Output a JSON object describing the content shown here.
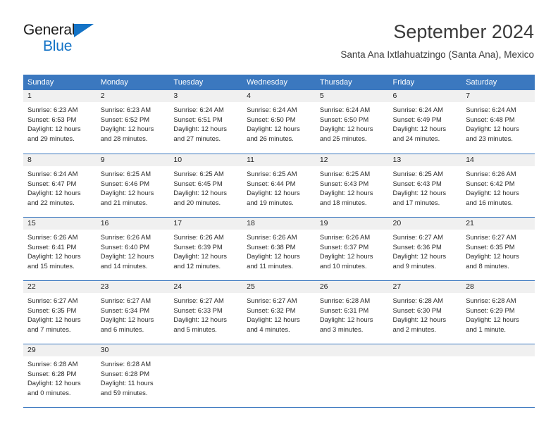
{
  "brand": {
    "name_top": "General",
    "name_bottom": "Blue",
    "triangle_icon": "blue-triangle-icon",
    "accent_color": "#1473c6"
  },
  "header": {
    "title": "September 2024",
    "subtitle": "Santa Ana Ixtlahuatzingo (Santa Ana), Mexico"
  },
  "theme": {
    "header_blue": "#3b78bf",
    "daynum_bg": "#f0f0f0",
    "text": "#222222"
  },
  "weekday_headers": [
    "Sunday",
    "Monday",
    "Tuesday",
    "Wednesday",
    "Thursday",
    "Friday",
    "Saturday"
  ],
  "labels": {
    "sunrise_prefix": "Sunrise:",
    "sunset_prefix": "Sunset:",
    "daylight_prefix": "Daylight:"
  },
  "weeks": [
    [
      {
        "day": "1",
        "sunrise": "Sunrise: 6:23 AM",
        "sunset": "Sunset: 6:53 PM",
        "daylight1": "Daylight: 12 hours",
        "daylight2": "and 29 minutes."
      },
      {
        "day": "2",
        "sunrise": "Sunrise: 6:23 AM",
        "sunset": "Sunset: 6:52 PM",
        "daylight1": "Daylight: 12 hours",
        "daylight2": "and 28 minutes."
      },
      {
        "day": "3",
        "sunrise": "Sunrise: 6:24 AM",
        "sunset": "Sunset: 6:51 PM",
        "daylight1": "Daylight: 12 hours",
        "daylight2": "and 27 minutes."
      },
      {
        "day": "4",
        "sunrise": "Sunrise: 6:24 AM",
        "sunset": "Sunset: 6:50 PM",
        "daylight1": "Daylight: 12 hours",
        "daylight2": "and 26 minutes."
      },
      {
        "day": "5",
        "sunrise": "Sunrise: 6:24 AM",
        "sunset": "Sunset: 6:50 PM",
        "daylight1": "Daylight: 12 hours",
        "daylight2": "and 25 minutes."
      },
      {
        "day": "6",
        "sunrise": "Sunrise: 6:24 AM",
        "sunset": "Sunset: 6:49 PM",
        "daylight1": "Daylight: 12 hours",
        "daylight2": "and 24 minutes."
      },
      {
        "day": "7",
        "sunrise": "Sunrise: 6:24 AM",
        "sunset": "Sunset: 6:48 PM",
        "daylight1": "Daylight: 12 hours",
        "daylight2": "and 23 minutes."
      }
    ],
    [
      {
        "day": "8",
        "sunrise": "Sunrise: 6:24 AM",
        "sunset": "Sunset: 6:47 PM",
        "daylight1": "Daylight: 12 hours",
        "daylight2": "and 22 minutes."
      },
      {
        "day": "9",
        "sunrise": "Sunrise: 6:25 AM",
        "sunset": "Sunset: 6:46 PM",
        "daylight1": "Daylight: 12 hours",
        "daylight2": "and 21 minutes."
      },
      {
        "day": "10",
        "sunrise": "Sunrise: 6:25 AM",
        "sunset": "Sunset: 6:45 PM",
        "daylight1": "Daylight: 12 hours",
        "daylight2": "and 20 minutes."
      },
      {
        "day": "11",
        "sunrise": "Sunrise: 6:25 AM",
        "sunset": "Sunset: 6:44 PM",
        "daylight1": "Daylight: 12 hours",
        "daylight2": "and 19 minutes."
      },
      {
        "day": "12",
        "sunrise": "Sunrise: 6:25 AM",
        "sunset": "Sunset: 6:43 PM",
        "daylight1": "Daylight: 12 hours",
        "daylight2": "and 18 minutes."
      },
      {
        "day": "13",
        "sunrise": "Sunrise: 6:25 AM",
        "sunset": "Sunset: 6:43 PM",
        "daylight1": "Daylight: 12 hours",
        "daylight2": "and 17 minutes."
      },
      {
        "day": "14",
        "sunrise": "Sunrise: 6:26 AM",
        "sunset": "Sunset: 6:42 PM",
        "daylight1": "Daylight: 12 hours",
        "daylight2": "and 16 minutes."
      }
    ],
    [
      {
        "day": "15",
        "sunrise": "Sunrise: 6:26 AM",
        "sunset": "Sunset: 6:41 PM",
        "daylight1": "Daylight: 12 hours",
        "daylight2": "and 15 minutes."
      },
      {
        "day": "16",
        "sunrise": "Sunrise: 6:26 AM",
        "sunset": "Sunset: 6:40 PM",
        "daylight1": "Daylight: 12 hours",
        "daylight2": "and 14 minutes."
      },
      {
        "day": "17",
        "sunrise": "Sunrise: 6:26 AM",
        "sunset": "Sunset: 6:39 PM",
        "daylight1": "Daylight: 12 hours",
        "daylight2": "and 12 minutes."
      },
      {
        "day": "18",
        "sunrise": "Sunrise: 6:26 AM",
        "sunset": "Sunset: 6:38 PM",
        "daylight1": "Daylight: 12 hours",
        "daylight2": "and 11 minutes."
      },
      {
        "day": "19",
        "sunrise": "Sunrise: 6:26 AM",
        "sunset": "Sunset: 6:37 PM",
        "daylight1": "Daylight: 12 hours",
        "daylight2": "and 10 minutes."
      },
      {
        "day": "20",
        "sunrise": "Sunrise: 6:27 AM",
        "sunset": "Sunset: 6:36 PM",
        "daylight1": "Daylight: 12 hours",
        "daylight2": "and 9 minutes."
      },
      {
        "day": "21",
        "sunrise": "Sunrise: 6:27 AM",
        "sunset": "Sunset: 6:35 PM",
        "daylight1": "Daylight: 12 hours",
        "daylight2": "and 8 minutes."
      }
    ],
    [
      {
        "day": "22",
        "sunrise": "Sunrise: 6:27 AM",
        "sunset": "Sunset: 6:35 PM",
        "daylight1": "Daylight: 12 hours",
        "daylight2": "and 7 minutes."
      },
      {
        "day": "23",
        "sunrise": "Sunrise: 6:27 AM",
        "sunset": "Sunset: 6:34 PM",
        "daylight1": "Daylight: 12 hours",
        "daylight2": "and 6 minutes."
      },
      {
        "day": "24",
        "sunrise": "Sunrise: 6:27 AM",
        "sunset": "Sunset: 6:33 PM",
        "daylight1": "Daylight: 12 hours",
        "daylight2": "and 5 minutes."
      },
      {
        "day": "25",
        "sunrise": "Sunrise: 6:27 AM",
        "sunset": "Sunset: 6:32 PM",
        "daylight1": "Daylight: 12 hours",
        "daylight2": "and 4 minutes."
      },
      {
        "day": "26",
        "sunrise": "Sunrise: 6:28 AM",
        "sunset": "Sunset: 6:31 PM",
        "daylight1": "Daylight: 12 hours",
        "daylight2": "and 3 minutes."
      },
      {
        "day": "27",
        "sunrise": "Sunrise: 6:28 AM",
        "sunset": "Sunset: 6:30 PM",
        "daylight1": "Daylight: 12 hours",
        "daylight2": "and 2 minutes."
      },
      {
        "day": "28",
        "sunrise": "Sunrise: 6:28 AM",
        "sunset": "Sunset: 6:29 PM",
        "daylight1": "Daylight: 12 hours",
        "daylight2": "and 1 minute."
      }
    ],
    [
      {
        "day": "29",
        "sunrise": "Sunrise: 6:28 AM",
        "sunset": "Sunset: 6:28 PM",
        "daylight1": "Daylight: 12 hours",
        "daylight2": "and 0 minutes."
      },
      {
        "day": "30",
        "sunrise": "Sunrise: 6:28 AM",
        "sunset": "Sunset: 6:28 PM",
        "daylight1": "Daylight: 11 hours",
        "daylight2": "and 59 minutes."
      },
      {
        "day": "",
        "sunrise": "",
        "sunset": "",
        "daylight1": "",
        "daylight2": ""
      },
      {
        "day": "",
        "sunrise": "",
        "sunset": "",
        "daylight1": "",
        "daylight2": ""
      },
      {
        "day": "",
        "sunrise": "",
        "sunset": "",
        "daylight1": "",
        "daylight2": ""
      },
      {
        "day": "",
        "sunrise": "",
        "sunset": "",
        "daylight1": "",
        "daylight2": ""
      },
      {
        "day": "",
        "sunrise": "",
        "sunset": "",
        "daylight1": "",
        "daylight2": ""
      }
    ]
  ]
}
